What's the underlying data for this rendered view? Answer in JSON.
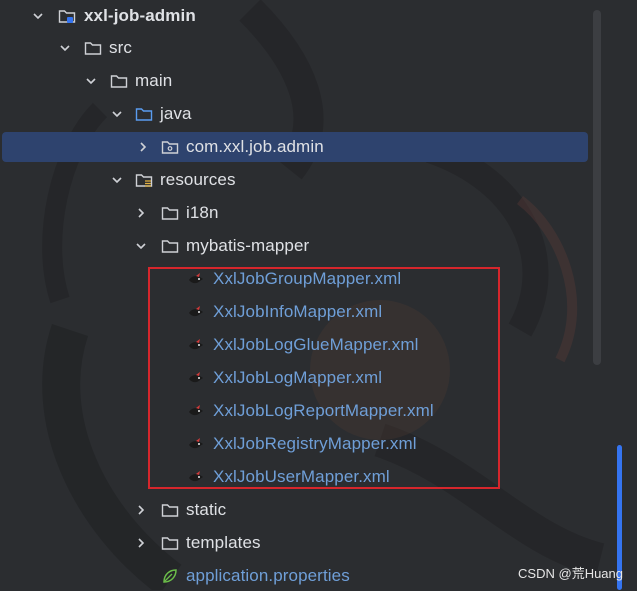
{
  "tree": {
    "root": {
      "label": "xxl-job-admin"
    },
    "src": {
      "label": "src"
    },
    "main": {
      "label": "main"
    },
    "java": {
      "label": "java"
    },
    "package": {
      "label": "com.xxl.job.admin"
    },
    "resources": {
      "label": "resources"
    },
    "i18n": {
      "label": "i18n"
    },
    "mybatis_mapper": {
      "label": "mybatis-mapper"
    },
    "mapper_files": [
      {
        "label": "XxlJobGroupMapper.xml"
      },
      {
        "label": "XxlJobInfoMapper.xml"
      },
      {
        "label": "XxlJobLogGlueMapper.xml"
      },
      {
        "label": "XxlJobLogMapper.xml"
      },
      {
        "label": "XxlJobLogReportMapper.xml"
      },
      {
        "label": "XxlJobRegistryMapper.xml"
      },
      {
        "label": "XxlJobUserMapper.xml"
      }
    ],
    "static": {
      "label": "static"
    },
    "templates": {
      "label": "templates"
    },
    "application_properties": {
      "label": "application.properties"
    }
  },
  "watermark": "CSDN @荒Huang",
  "colors": {
    "background": "#2b2d30",
    "selection": "#2e436e",
    "highlight_border": "#d6262c",
    "xml_text": "#6f9fd8",
    "default_text": "#dfe1e5"
  }
}
